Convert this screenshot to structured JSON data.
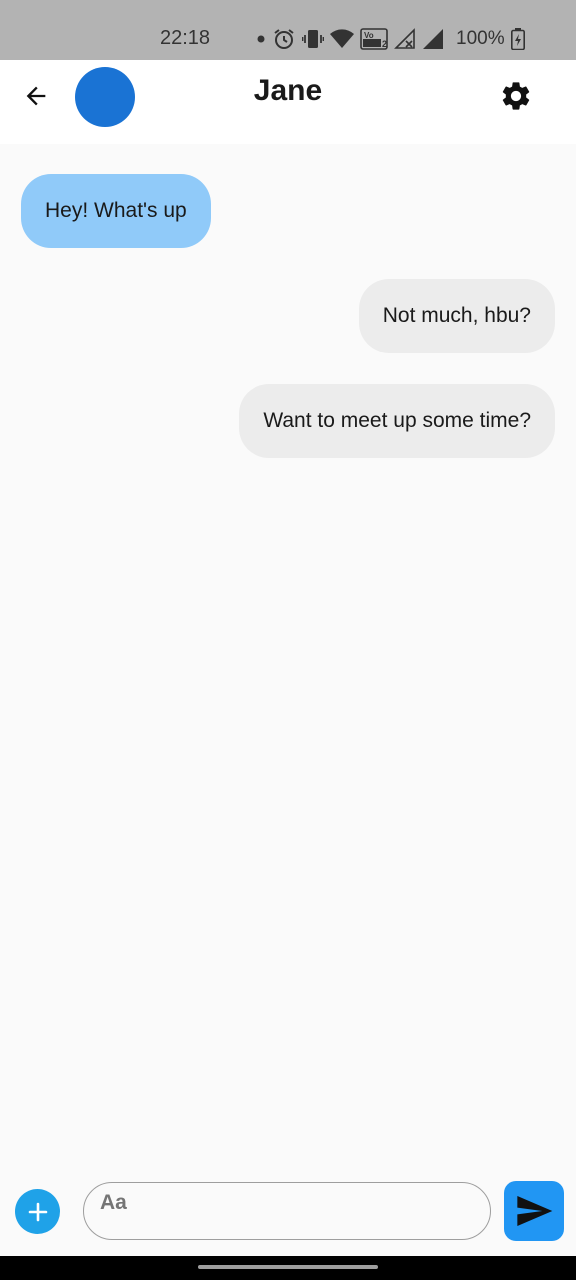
{
  "status_bar": {
    "time": "22:18",
    "battery": "100%",
    "icons": [
      "notification-dot-icon",
      "alarm-icon",
      "vibrate-icon",
      "wifi-icon",
      "volte-icon",
      "no-signal-icon",
      "signal-icon",
      "battery-charging-icon"
    ]
  },
  "header": {
    "contact_name": "Jane",
    "avatar_color": "#1a73d4",
    "back_icon": "arrow-left-icon",
    "settings_icon": "gear-icon"
  },
  "messages": [
    {
      "text": "Hey! What's up",
      "direction": "incoming"
    },
    {
      "text": "Not much, hbu?",
      "direction": "outgoing"
    },
    {
      "text": "Want to meet up some time?",
      "direction": "outgoing"
    }
  ],
  "composer": {
    "placeholder": "Aa",
    "value": "",
    "add_icon": "plus-icon",
    "send_icon": "send-icon"
  },
  "colors": {
    "incoming_bubble": "#90caf9",
    "outgoing_bubble": "#ececec",
    "accent": "#2196f3"
  }
}
